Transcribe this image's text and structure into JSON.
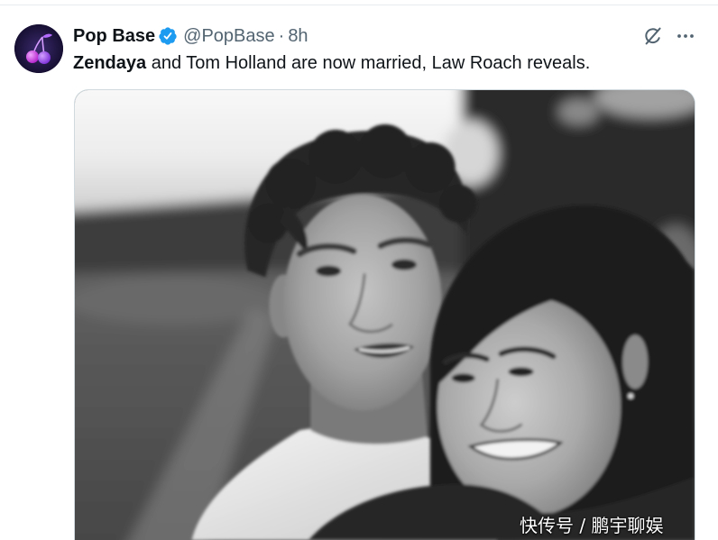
{
  "tweet": {
    "author": {
      "name": "Pop Base",
      "handle": "@PopBase",
      "separator": "·",
      "time": "8h",
      "verified": true,
      "avatar_icon": "cherry-icon",
      "verified_icon": "verified-badge-icon"
    },
    "text": {
      "bold": "Zendaya",
      "rest": " and Tom Holland are now married, Law Roach reveals."
    },
    "actions": {
      "grok_icon": "grok-icon",
      "more_icon": "more-icon"
    },
    "media": {
      "watermark": "快传号 / 鹏宇聊娱"
    }
  },
  "colors": {
    "text": "#0f1419",
    "secondary": "#536471",
    "verified": "#1d9bf0",
    "border": "#cfd9de",
    "avatar_bg": "#1a1238"
  }
}
